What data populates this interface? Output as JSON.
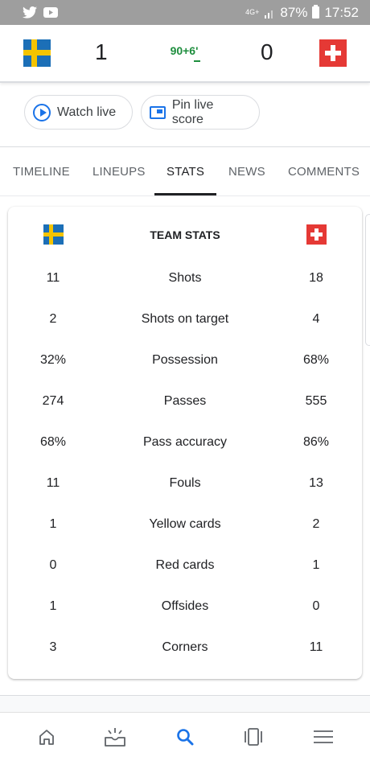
{
  "status_bar": {
    "network": "4G+",
    "battery": "87%",
    "time": "17:52"
  },
  "match": {
    "home_score": "1",
    "away_score": "0",
    "minute": "90+6'"
  },
  "chips": {
    "watch_live": "Watch live",
    "pin_live_score": "Pin live score"
  },
  "tabs": [
    {
      "label": "TIMELINE"
    },
    {
      "label": "LINEUPS"
    },
    {
      "label": "STATS",
      "active": true
    },
    {
      "label": "NEWS"
    },
    {
      "label": "COMMENTS"
    }
  ],
  "stats": {
    "title": "TEAM STATS",
    "rows": [
      {
        "home": "11",
        "label": "Shots",
        "away": "18"
      },
      {
        "home": "2",
        "label": "Shots on target",
        "away": "4"
      },
      {
        "home": "32%",
        "label": "Possession",
        "away": "68%"
      },
      {
        "home": "274",
        "label": "Passes",
        "away": "555"
      },
      {
        "home": "68%",
        "label": "Pass accuracy",
        "away": "86%"
      },
      {
        "home": "11",
        "label": "Fouls",
        "away": "13"
      },
      {
        "home": "1",
        "label": "Yellow cards",
        "away": "2"
      },
      {
        "home": "0",
        "label": "Red cards",
        "away": "1"
      },
      {
        "home": "1",
        "label": "Offsides",
        "away": "0"
      },
      {
        "home": "3",
        "label": "Corners",
        "away": "11"
      }
    ]
  },
  "icons": {
    "twitter": "twitter-icon",
    "youtube": "youtube-icon",
    "home": "home-icon",
    "updates": "updates-icon",
    "search": "search-icon",
    "tabs": "tabs-icon",
    "menu": "menu-icon"
  },
  "colors": {
    "accent_blue": "#1a73e8",
    "live_green": "#1e8e3e",
    "sweden_blue": "#1c6fb7",
    "sweden_yellow": "#f5c400",
    "swiss_red": "#e53935"
  }
}
